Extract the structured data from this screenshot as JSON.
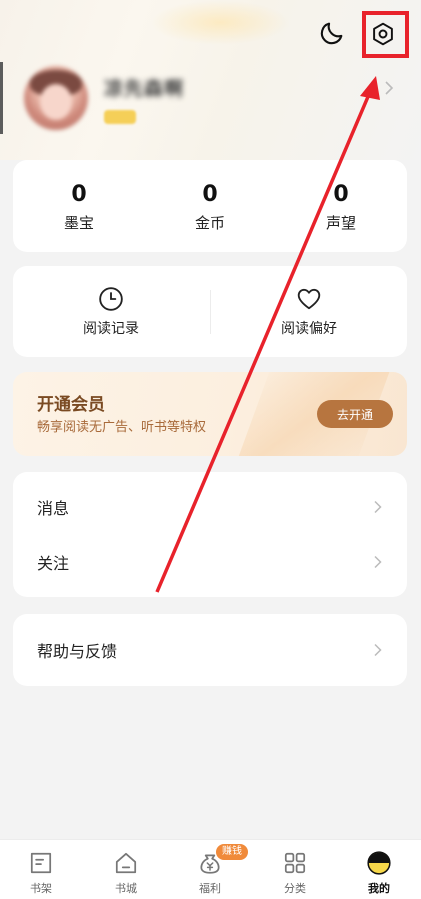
{
  "header": {
    "moon_icon": "moon-icon",
    "settings_icon": "gear-icon",
    "highlight_color": "#e8222b"
  },
  "profile": {
    "username": "凉先森啊"
  },
  "stats": [
    {
      "value": "0",
      "label": "墨宝"
    },
    {
      "value": "0",
      "label": "金币"
    },
    {
      "value": "0",
      "label": "声望"
    }
  ],
  "reading": {
    "history_label": "阅读记录",
    "preference_label": "阅读偏好"
  },
  "vip": {
    "title": "开通会员",
    "subtitle": "畅享阅读无广告、听书等特权",
    "button": "去开通",
    "accent": "#b7753f"
  },
  "menu": {
    "messages": "消息",
    "follow": "关注",
    "help": "帮助与反馈"
  },
  "nav": {
    "items": [
      {
        "label": "书架",
        "icon": "bookshelf-icon"
      },
      {
        "label": "书城",
        "icon": "store-icon"
      },
      {
        "label": "福利",
        "icon": "money-bag-icon"
      },
      {
        "label": "分类",
        "icon": "grid-icon"
      },
      {
        "label": "我的",
        "icon": "profile-icon"
      }
    ],
    "earn_badge": "赚钱",
    "active_index": 4
  }
}
